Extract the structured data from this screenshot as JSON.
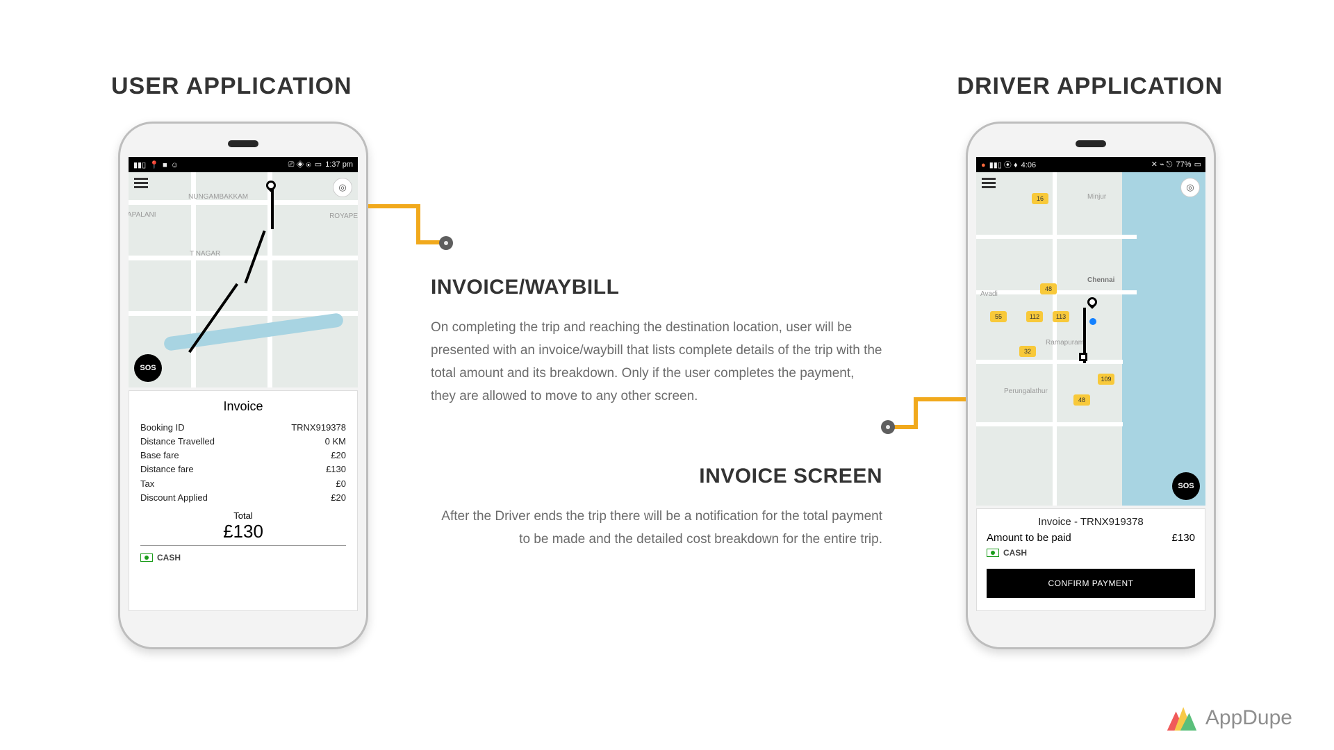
{
  "headings": {
    "user": "USER APPLICATION",
    "driver": "DRIVER APPLICATION"
  },
  "center": {
    "block1": {
      "title": "INVOICE/WAYBILL",
      "body": "On completing the trip and reaching the destination location, user will be presented with an invoice/waybill that lists complete details of the trip with the total amount and its breakdown. Only if the user completes the payment, they are allowed to move to any other screen."
    },
    "block2": {
      "title": "INVOICE SCREEN",
      "body": "After the Driver ends the trip there will be a notification for the total payment to be made and the detailed cost breakdown for the entire trip."
    }
  },
  "user_app": {
    "status_time": "1:37 pm",
    "map_labels": [
      "NUNGAMBAKKAM",
      "T NAGAR",
      "APALANI",
      "ROYAPE"
    ],
    "sos": "SOS",
    "invoice": {
      "title": "Invoice",
      "rows": [
        {
          "label": "Booking ID",
          "value": "TRNX919378"
        },
        {
          "label": "Distance Travelled",
          "value": "0 KM"
        },
        {
          "label": "Base fare",
          "value": "£20"
        },
        {
          "label": "Distance fare",
          "value": "£130"
        },
        {
          "label": "Tax",
          "value": "£0"
        },
        {
          "label": "Discount Applied",
          "value": "£20"
        }
      ],
      "total_label": "Total",
      "total_value": "£130",
      "payment": "CASH"
    }
  },
  "driver_app": {
    "status_time": "4:06",
    "status_batt": "77%",
    "map_labels": [
      "Chennai",
      "Avadi",
      "Minjur",
      "Ramapuram",
      "Perungalathur"
    ],
    "shields": [
      "16",
      "48",
      "55",
      "112",
      "113",
      "32",
      "109",
      "48"
    ],
    "sos": "SOS",
    "invoice": {
      "title": "Invoice - TRNX919378",
      "amount_label": "Amount to be paid",
      "amount_value": "£130",
      "payment": "CASH",
      "confirm": "CONFIRM PAYMENT"
    }
  },
  "brand": "AppDupe"
}
